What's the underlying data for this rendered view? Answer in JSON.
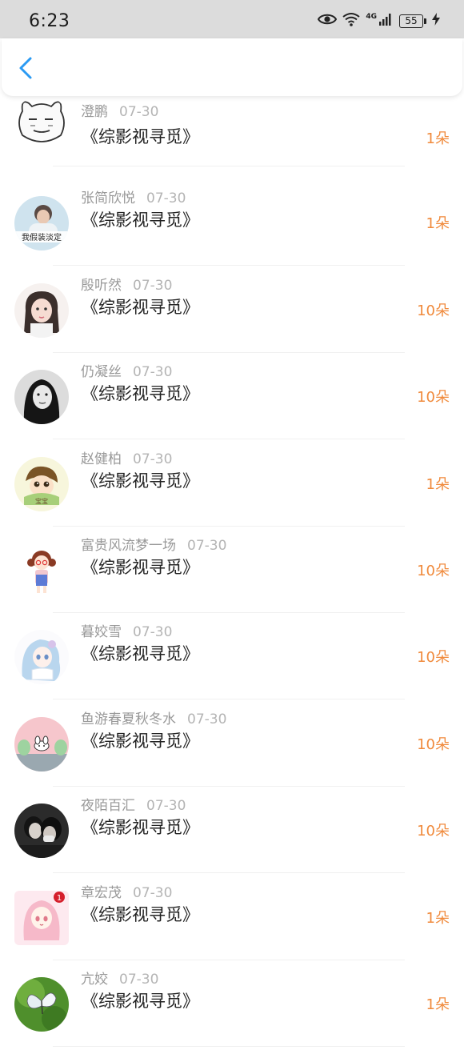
{
  "status_bar": {
    "time": "6:23",
    "network": "4G",
    "battery": "55",
    "icons": [
      "eye-icon",
      "wifi-icon",
      "signal-icon",
      "battery-icon",
      "charging-icon"
    ]
  },
  "nav": {
    "back_icon": "chevron-left-icon",
    "accent": "#2a9af3"
  },
  "accent_amount": "#f08a3c",
  "items": [
    {
      "name": "澄鹏",
      "date": "07-30",
      "title": "《综影视寻觅》",
      "amount": "1朵",
      "avatar": "meme-face"
    },
    {
      "name": "张简欣悦",
      "date": "07-30",
      "title": "《综影视寻觅》",
      "amount": "1朵",
      "avatar": "photo-with-caption",
      "avatar_caption": "我假装淡定"
    },
    {
      "name": "殷听然",
      "date": "07-30",
      "title": "《综影视寻觅》",
      "amount": "10朵",
      "avatar": "girl-portrait"
    },
    {
      "name": "仍凝丝",
      "date": "07-30",
      "title": "《综影视寻觅》",
      "amount": "10朵",
      "avatar": "bw-portrait"
    },
    {
      "name": "赵健柏",
      "date": "07-30",
      "title": "《综影视寻觅》",
      "amount": "1朵",
      "avatar": "cartoon-boy",
      "avatar_caption": "宝宝"
    },
    {
      "name": "富贵风流梦一场",
      "date": "07-30",
      "title": "《综影视寻觅》",
      "amount": "10朵",
      "avatar": "cartoon-girl"
    },
    {
      "name": "暮姣雪",
      "date": "07-30",
      "title": "《综影视寻觅》",
      "amount": "10朵",
      "avatar": "anime-blue-hair"
    },
    {
      "name": "鱼游春夏秋冬水",
      "date": "07-30",
      "title": "《综影视寻觅》",
      "amount": "10朵",
      "avatar": "pink-bunny"
    },
    {
      "name": "夜陌百汇",
      "date": "07-30",
      "title": "《综影视寻觅》",
      "amount": "10朵",
      "avatar": "couple-dark"
    },
    {
      "name": "章宏茂",
      "date": "07-30",
      "title": "《综影视寻觅》",
      "amount": "1朵",
      "avatar": "anime-pink-hair"
    },
    {
      "name": "亢姣",
      "date": "07-30",
      "title": "《综影视寻觅》",
      "amount": "1朵",
      "avatar": "butterfly-green"
    }
  ]
}
